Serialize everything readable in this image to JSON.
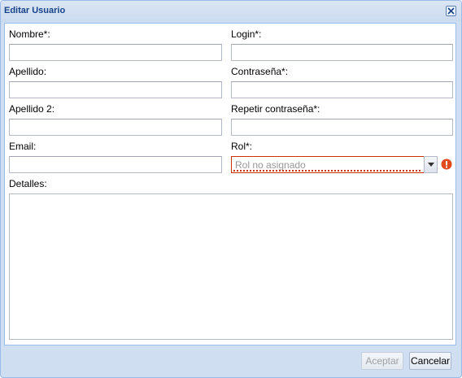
{
  "window": {
    "title": "Editar Usuario"
  },
  "form": {
    "nombre": {
      "label": "Nombre*:",
      "value": ""
    },
    "login": {
      "label": "Login*:",
      "value": ""
    },
    "apellido": {
      "label": "Apellido:",
      "value": ""
    },
    "contrasena": {
      "label": "Contraseña*:",
      "value": ""
    },
    "apellido2": {
      "label": "Apellido 2:",
      "value": ""
    },
    "repetir": {
      "label": "Repetir contraseña*:",
      "value": ""
    },
    "email": {
      "label": "Email:",
      "value": ""
    },
    "rol": {
      "label": "Rol*:",
      "placeholder": "Rol no asignado"
    },
    "detalles": {
      "label": "Detalles:",
      "value": ""
    }
  },
  "buttons": {
    "accept": "Aceptar",
    "cancel": "Cancelar"
  },
  "icons": {
    "close": "close-icon",
    "dropdown": "chevron-down-icon",
    "error": "error-icon"
  },
  "colors": {
    "title": "#15428b",
    "error": "#cc3300",
    "window_bg": "#cfdef1"
  }
}
